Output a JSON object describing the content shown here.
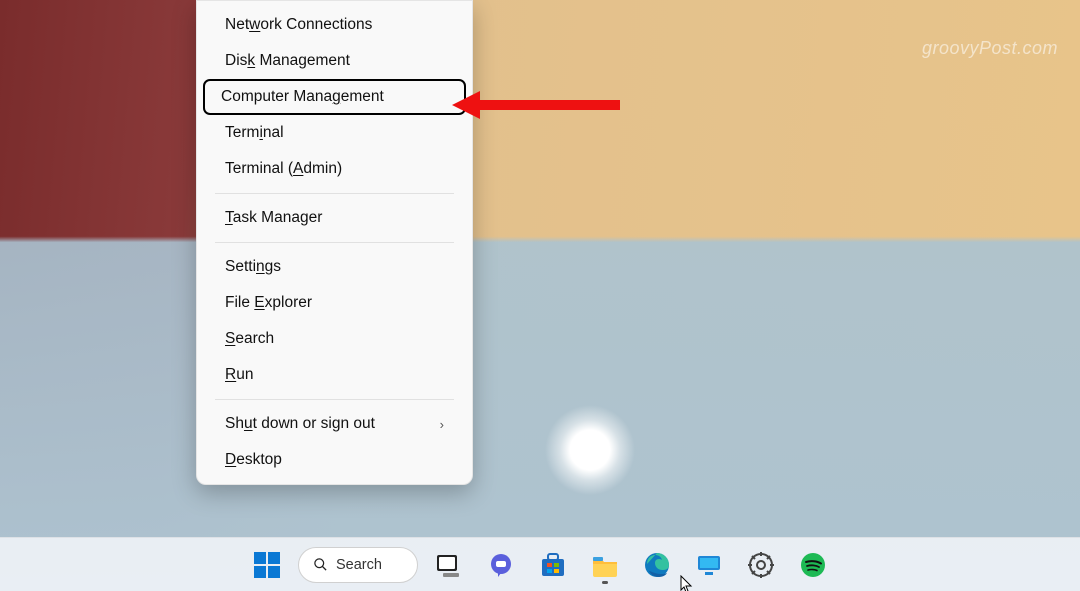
{
  "watermark": "groovyPost.com",
  "menu": {
    "items": [
      {
        "pre": "Net",
        "acc": "w",
        "post": "ork Connections"
      },
      {
        "pre": "Dis",
        "acc": "k",
        "post": " Management"
      },
      {
        "pre": "Computer Mana",
        "acc": "g",
        "post": "ement",
        "highlight": true
      },
      {
        "pre": "Term",
        "acc": "i",
        "post": "nal"
      },
      {
        "pre": "Terminal (",
        "acc": "A",
        "post": "dmin)"
      }
    ],
    "group2": [
      {
        "pre": "",
        "acc": "T",
        "post": "ask Manager"
      }
    ],
    "group3": [
      {
        "pre": "Setti",
        "acc": "n",
        "post": "gs"
      },
      {
        "pre": "File ",
        "acc": "E",
        "post": "xplorer"
      },
      {
        "pre": "",
        "acc": "S",
        "post": "earch"
      },
      {
        "pre": "",
        "acc": "R",
        "post": "un"
      }
    ],
    "group4": [
      {
        "pre": "Sh",
        "acc": "u",
        "post": "t down or sign out",
        "submenu": true
      },
      {
        "pre": "",
        "acc": "D",
        "post": "esktop"
      }
    ]
  },
  "taskbar": {
    "search_label": "Search"
  }
}
